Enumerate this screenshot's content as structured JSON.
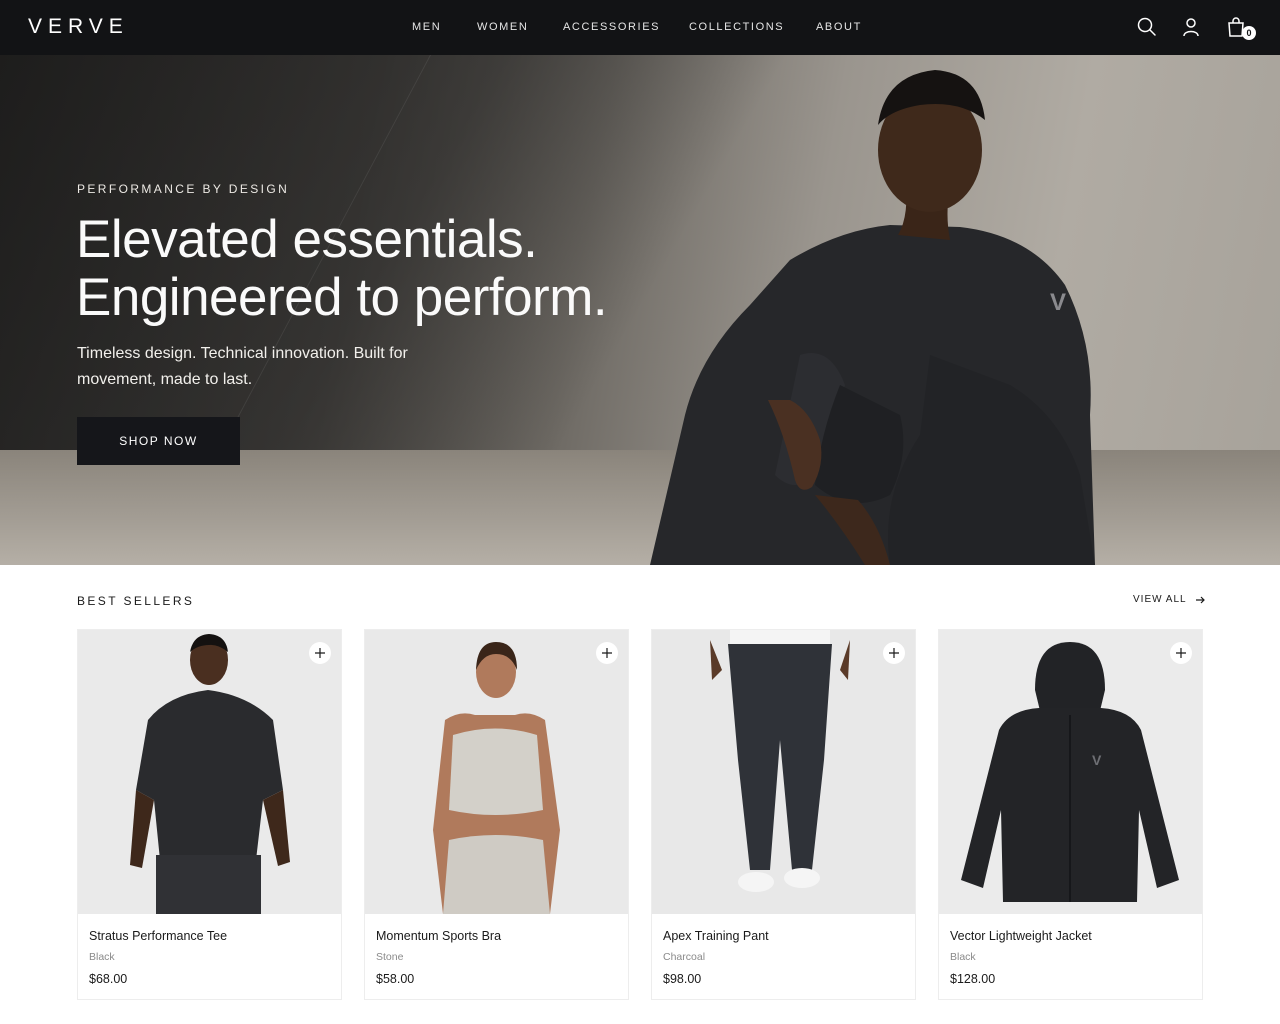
{
  "brand": {
    "logo_text": "VERVE"
  },
  "nav": {
    "items": [
      "MEN",
      "WOMEN",
      "ACCESSORIES",
      "COLLECTIONS",
      "ABOUT"
    ]
  },
  "header_icons": {
    "search": "search-icon",
    "account": "account-icon",
    "bag": "shopping-bag-icon",
    "bag_count": "0"
  },
  "hero": {
    "eyebrow": "PERFORMANCE BY DESIGN",
    "title_line1": "Elevated essentials.",
    "title_line2": "Engineered to perform.",
    "subtitle": "Timeless design. Technical innovation. Built for movement, made to last.",
    "cta_label": "SHOP NOW"
  },
  "best_sellers": {
    "title": "BEST SELLERS",
    "view_all_label": "VIEW ALL",
    "products": [
      {
        "name": "Stratus Performance Tee",
        "color": "Black",
        "price": "$68.00"
      },
      {
        "name": "Momentum Sports Bra",
        "color": "Stone",
        "price": "$58.00"
      },
      {
        "name": "Apex Training Pant",
        "color": "Charcoal",
        "price": "$98.00"
      },
      {
        "name": "Vector Lightweight Jacket",
        "color": "Black",
        "price": "$128.00"
      }
    ]
  },
  "colors": {
    "header_bg": "#121315",
    "button_bg": "#15161a",
    "text_primary": "#1a1a1a",
    "text_muted": "#8a8a8a"
  }
}
